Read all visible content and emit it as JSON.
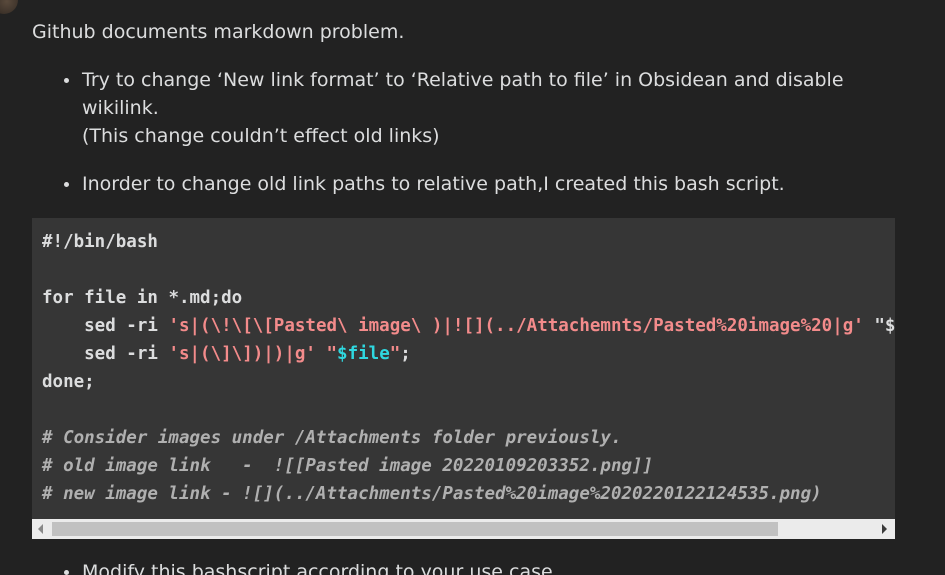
{
  "intro": "Github documents markdown problem.",
  "bullets_top": [
    {
      "line1": "Try to change ‘New link format’ to ‘Relative path to file’ in Obsidean and disable",
      "line2": "wikilink.",
      "line3": "(This change couldn’t effect old links)"
    }
  ],
  "bullet_second": "Inorder to change old link paths to relative path,I created this bash script.",
  "code": {
    "shebang": "#!/bin/bash",
    "for_kw": "for",
    "for_mid": " file ",
    "in_kw": "in",
    "for_tail": " *.md;",
    "do_kw": "do",
    "sed1_cmd": "    sed -ri ",
    "sed1_str": "'s|(\\!\\[\\[Pasted\\ image\\ )|![](../Attachemnts/Pasted%20image%20|g'",
    "sed1_rest": " \"$file\";",
    "sed2_cmd": "    sed -ri ",
    "sed2_str": "'s|(\\]\\])|)|g'",
    "sed2_space": " ",
    "sed2_q1": "\"",
    "sed2_var": "$file",
    "sed2_q2": "\"",
    "sed2_end": ";",
    "done_kw": "done",
    "done_end": ";",
    "comment1": "# Consider images under /Attachments folder previously.",
    "comment2": "# old image link   -  ![[Pasted image 20220109203352.png]]",
    "comment3": "# new image link - ![](../Attachments/Pasted%20image%2020220122124535.png)"
  },
  "bullet_third": "Modify this bashscript according to your use case.",
  "colors": {
    "background": "#222222",
    "code_background": "#363636",
    "string": "#f38b8b",
    "variable": "#2fd8e0",
    "comment": "#b0b0b0"
  }
}
